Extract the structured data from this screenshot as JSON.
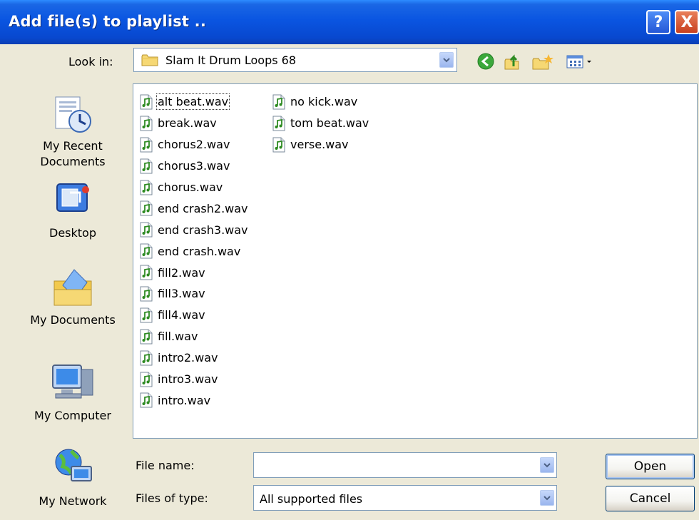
{
  "window": {
    "title": "Add file(s) to playlist ..",
    "help_label": "?",
    "close_label": "X"
  },
  "lookin": {
    "label": "Look in:",
    "value": "Slam It Drum Loops 68"
  },
  "toolbar": {
    "icons": [
      "back-icon",
      "up-folder-icon",
      "new-folder-icon",
      "views-menu-icon"
    ]
  },
  "places": [
    {
      "label_line1": "My Recent",
      "label_line2": "Documents",
      "icon": "recent-documents-icon"
    },
    {
      "label_line1": "Desktop",
      "label_line2": "",
      "icon": "desktop-icon"
    },
    {
      "label_line1": "My Documents",
      "label_line2": "",
      "icon": "my-documents-icon"
    },
    {
      "label_line1": "My Computer",
      "label_line2": "",
      "icon": "my-computer-icon"
    },
    {
      "label_line1": "My Network",
      "label_line2": "",
      "icon": "network-icon"
    }
  ],
  "files": {
    "column1": [
      "alt beat.wav",
      "break.wav",
      "chorus2.wav",
      "chorus3.wav",
      "chorus.wav",
      "end crash2.wav",
      "end crash3.wav",
      "end crash.wav",
      "fill2.wav",
      "fill3.wav",
      "fill4.wav",
      "fill.wav",
      "intro2.wav",
      "intro3.wav",
      "intro.wav"
    ],
    "column2": [
      "no kick.wav",
      "tom beat.wav",
      "verse.wav"
    ],
    "focused": "alt beat.wav"
  },
  "filename": {
    "label": "File name:",
    "value": ""
  },
  "filetype": {
    "label": "Files of type:",
    "value": "All supported files"
  },
  "buttons": {
    "open": "Open",
    "cancel": "Cancel"
  },
  "colors": {
    "titlebar": "#0A55E1",
    "dialog_bg": "#ECE9D8",
    "border": "#7F9DB9"
  }
}
